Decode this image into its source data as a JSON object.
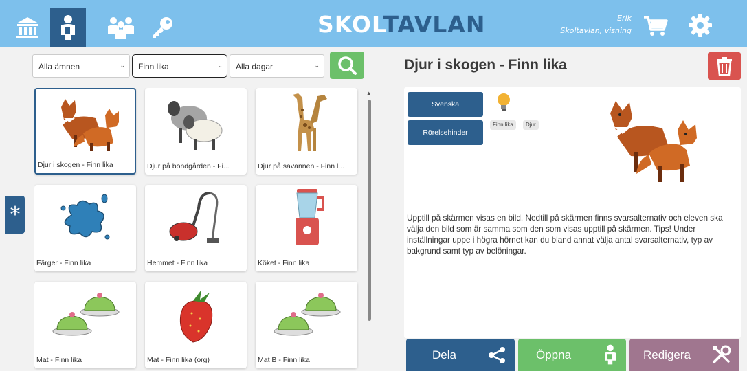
{
  "app": {
    "logo_part1": "SKOL",
    "logo_part2": "TAVLAN",
    "user_name": "Erik",
    "user_context": "Skoltavlan, visning"
  },
  "nav": {
    "items": [
      {
        "icon": "school-icon"
      },
      {
        "icon": "student-icon"
      },
      {
        "icon": "group-icon"
      },
      {
        "icon": "key-icon"
      }
    ]
  },
  "filters": {
    "subject": "Alla ämnen",
    "type": "Finn lika",
    "days": "Alla dagar"
  },
  "cards": [
    {
      "caption": "Djur i skogen - Finn lika",
      "image": "fox-icon"
    },
    {
      "caption": "Djur på bondgården - Fi...",
      "image": "sheep-icon"
    },
    {
      "caption": "Djur på savannen - Finn l...",
      "image": "giraffe-icon"
    },
    {
      "caption": "Färger - Finn lika",
      "image": "paint-splash-icon"
    },
    {
      "caption": "Hemmet - Finn lika",
      "image": "vacuum-cleaner-icon"
    },
    {
      "caption": "Köket - Finn lika",
      "image": "blender-icon"
    },
    {
      "caption": "Mat - Finn lika",
      "image": "princess-cake-icon"
    },
    {
      "caption": "Mat - Finn lika (org)",
      "image": "strawberry-icon"
    },
    {
      "caption": "Mat B - Finn lika",
      "image": "princess-cake-icon"
    }
  ],
  "sidebar_toggle": "*",
  "detail": {
    "title": "Djur i skogen - Finn lika",
    "tag_buttons": [
      "Svenska",
      "Rörelsehinder"
    ],
    "chips": [
      "Finn lika",
      "Djur"
    ],
    "description": "Upptill på skärmen visas en bild. Nedtill på skärmen finns svarsalternativ och eleven ska välja den bild som är samma som den som visas upptill på skärmen. Tips! Under inställningar uppe i högra hörnet kan du bland annat välja antal svarsalternativ, typ av bakgrund samt typ av belöningar."
  },
  "actions": {
    "share": "Dela",
    "open": "Öppna",
    "edit": "Redigera"
  },
  "colors": {
    "topbar": "#7dc0ec",
    "primary": "#2d5f8d",
    "green": "#6cc06a",
    "red": "#d9534f",
    "purple": "#a0768f"
  }
}
